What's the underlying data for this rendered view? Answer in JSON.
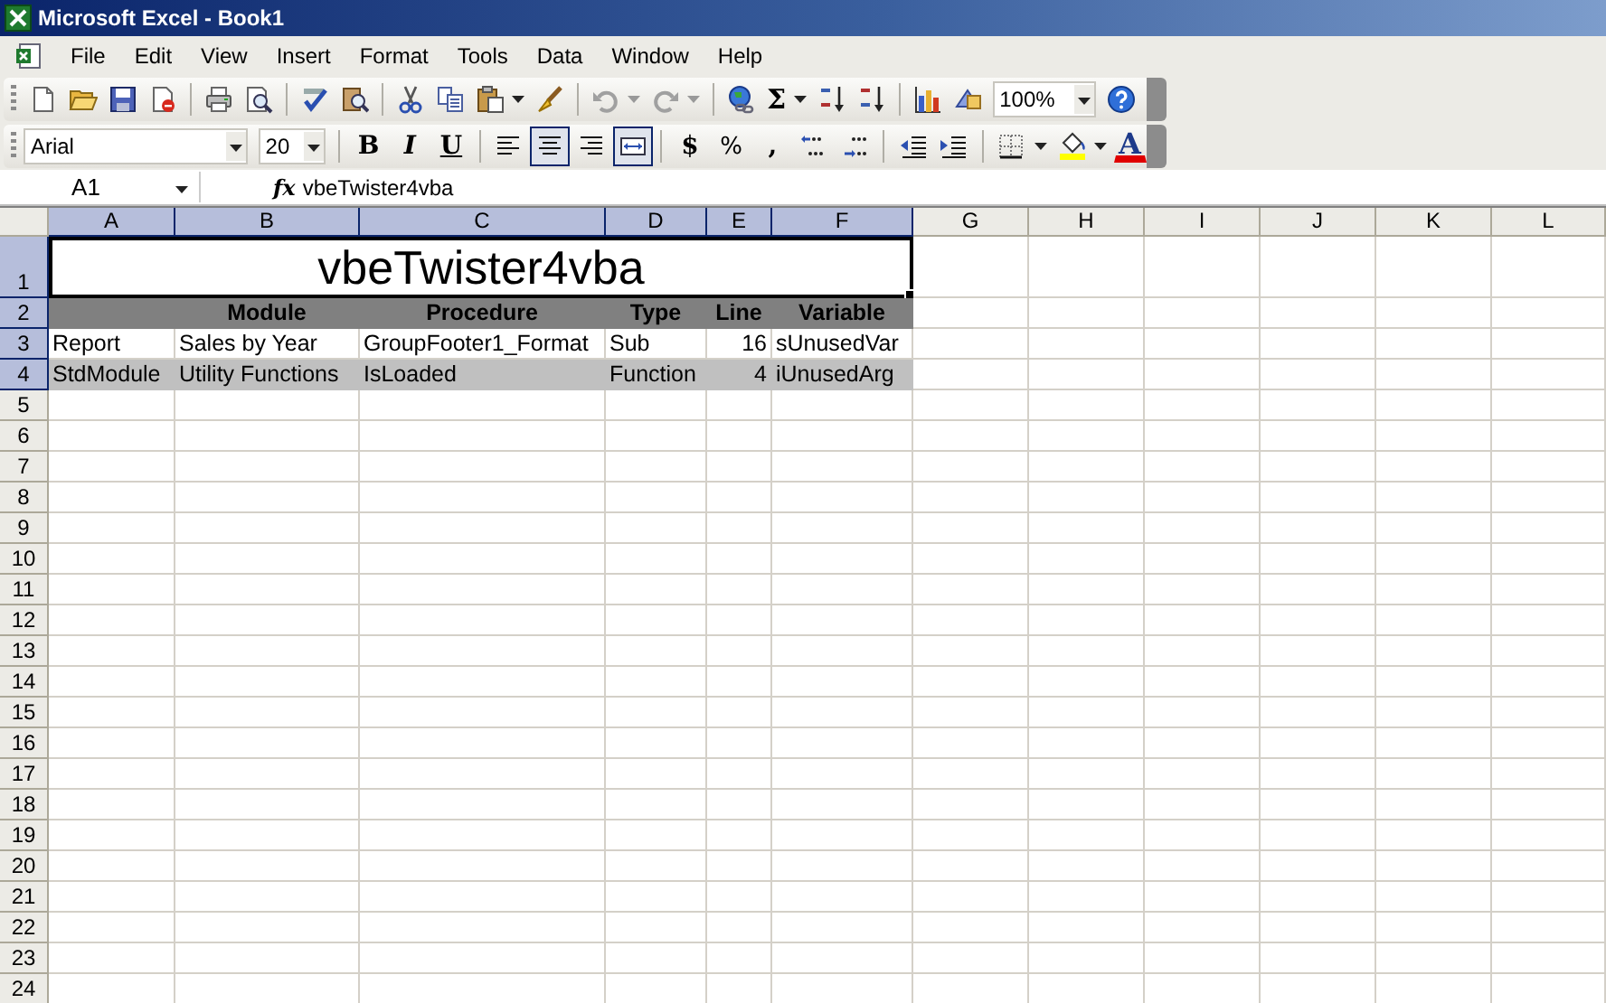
{
  "window": {
    "title": "Microsoft Excel - Book1"
  },
  "menu": [
    {
      "label": "File"
    },
    {
      "label": "Edit"
    },
    {
      "label": "View"
    },
    {
      "label": "Insert"
    },
    {
      "label": "Format"
    },
    {
      "label": "Tools"
    },
    {
      "label": "Data"
    },
    {
      "label": "Window"
    },
    {
      "label": "Help"
    }
  ],
  "standard_toolbar": {
    "sum": "Σ",
    "zoom": "100%"
  },
  "formatting_toolbar": {
    "font": "Arial",
    "size": "20",
    "groups": [
      [
        {
          "kind": "bold",
          "label": "B",
          "on": false
        },
        {
          "kind": "italic",
          "label": "I",
          "on": false
        },
        {
          "kind": "underline",
          "label": "U",
          "on": false
        }
      ],
      [
        {
          "kind": "align-left",
          "on": false
        },
        {
          "kind": "align-center",
          "on": true
        },
        {
          "kind": "align-right",
          "on": false
        },
        {
          "kind": "merge",
          "on": true
        }
      ],
      [
        {
          "kind": "currency",
          "label": "$",
          "on": false
        },
        {
          "kind": "percent",
          "label": "%",
          "on": false
        },
        {
          "kind": "comma",
          "label": ",",
          "on": false
        },
        {
          "kind": "increase-decimal",
          "on": false
        },
        {
          "kind": "decrease-decimal",
          "on": false
        }
      ],
      [
        {
          "kind": "decrease-indent",
          "on": false
        },
        {
          "kind": "increase-indent",
          "on": false
        }
      ],
      [
        {
          "kind": "borders",
          "on": false
        },
        {
          "kind": "fill-color",
          "on": false
        },
        {
          "kind": "font-color",
          "label": "A",
          "on": false
        }
      ]
    ]
  },
  "formula_bar": {
    "name_box": "A1",
    "function_label": "fx",
    "formula": "vbeTwister4vba"
  },
  "sheet": {
    "columns": [
      {
        "letter": "A",
        "selected": true
      },
      {
        "letter": "B",
        "selected": true
      },
      {
        "letter": "C",
        "selected": true
      },
      {
        "letter": "D",
        "selected": true
      },
      {
        "letter": "E",
        "selected": true
      },
      {
        "letter": "F",
        "selected": true
      },
      {
        "letter": "G",
        "selected": false
      },
      {
        "letter": "H",
        "selected": false
      },
      {
        "letter": "I",
        "selected": false
      },
      {
        "letter": "J",
        "selected": false
      },
      {
        "letter": "K",
        "selected": false
      },
      {
        "letter": "L",
        "selected": false
      }
    ],
    "rows": [
      {
        "number": "1",
        "selected": true,
        "kind": "title",
        "cells": [
          {
            "kind": "merged",
            "text": "vbeTwister4vba",
            "active": true
          }
        ]
      },
      {
        "number": "2",
        "selected": true,
        "kind": "header",
        "cells": [
          {
            "kind": "blank"
          },
          {
            "kind": "text",
            "text": "Module"
          },
          {
            "kind": "text",
            "text": "Procedure"
          },
          {
            "kind": "text",
            "text": "Type"
          },
          {
            "kind": "text",
            "text": "Line"
          },
          {
            "kind": "text",
            "text": "Variable"
          }
        ]
      },
      {
        "number": "3",
        "selected": true,
        "kind": "plain",
        "cells": [
          {
            "kind": "text",
            "text": "Report"
          },
          {
            "kind": "text",
            "text": "Sales by Year"
          },
          {
            "kind": "text",
            "text": "GroupFooter1_Format"
          },
          {
            "kind": "text",
            "text": "Sub"
          },
          {
            "kind": "number",
            "text": "16"
          },
          {
            "kind": "text",
            "text": "sUnusedVar"
          }
        ]
      },
      {
        "number": "4",
        "selected": true,
        "kind": "shaded",
        "cells": [
          {
            "kind": "text",
            "text": "StdModule"
          },
          {
            "kind": "text",
            "text": "Utility Functions"
          },
          {
            "kind": "text",
            "text": "IsLoaded"
          },
          {
            "kind": "text",
            "text": "Function"
          },
          {
            "kind": "number",
            "text": "4"
          },
          {
            "kind": "text",
            "text": "iUnusedArg"
          }
        ]
      },
      {
        "number": "5",
        "selected": false
      },
      {
        "number": "6",
        "selected": false
      },
      {
        "number": "7",
        "selected": false
      },
      {
        "number": "8",
        "selected": false
      },
      {
        "number": "9",
        "selected": false
      },
      {
        "number": "10",
        "selected": false
      },
      {
        "number": "11",
        "selected": false
      },
      {
        "number": "12",
        "selected": false
      },
      {
        "number": "13",
        "selected": false
      },
      {
        "number": "14",
        "selected": false
      },
      {
        "number": "15",
        "selected": false
      },
      {
        "number": "16",
        "selected": false
      },
      {
        "number": "17",
        "selected": false
      },
      {
        "number": "18",
        "selected": false
      },
      {
        "number": "19",
        "selected": false
      },
      {
        "number": "20",
        "selected": false
      },
      {
        "number": "21",
        "selected": false
      },
      {
        "number": "22",
        "selected": false
      },
      {
        "number": "23",
        "selected": false
      },
      {
        "number": "24",
        "selected": false
      }
    ]
  }
}
